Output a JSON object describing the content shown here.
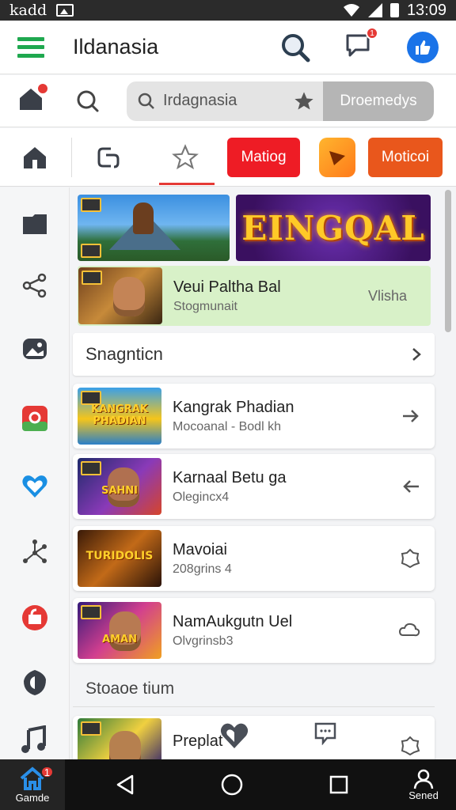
{
  "status_bar": {
    "carrier": "kadd",
    "time": "13:09"
  },
  "app_bar": {
    "title": "Ildanasia",
    "notification_count": "1"
  },
  "search": {
    "query": "Irdagnasia",
    "action_label": "Droemedys"
  },
  "tabs": {
    "button_a": "Matiog",
    "button_b": "Moticoi"
  },
  "featured": {
    "banner_title": "EINGQAL",
    "title": "Veui Paltha Bal",
    "subtitle": "Stogmunait",
    "side_label": "Vlisha"
  },
  "section_header": {
    "label": "Snagnticn"
  },
  "cards": [
    {
      "title": "Kangrak Phadian",
      "subtitle": "Mocoanal - Bodl kh",
      "thumb_text": "KANGRAK PHADIAN"
    },
    {
      "title": "Karnaal Betu ga",
      "subtitle": "Olegincx4",
      "thumb_text": "SAHNI"
    },
    {
      "title": "Mavoiai",
      "subtitle": "208grins 4",
      "thumb_text": "TURIDOLIS"
    },
    {
      "title": "NamAukgutn Uel",
      "subtitle": "Olvgrinsb3",
      "thumb_text": "AMAN"
    }
  ],
  "section2": {
    "label": "Stoaoe tium"
  },
  "partial_card": {
    "title": "Preplat"
  },
  "nav": {
    "home_label": "Gamde",
    "send_label": "Sened",
    "home_badge": "1"
  },
  "colors": {
    "accent_green": "#1fa84f",
    "accent_red": "#ee1c25",
    "accent_blue": "#1a73e8",
    "featured_bg": "#d8f1c8"
  }
}
